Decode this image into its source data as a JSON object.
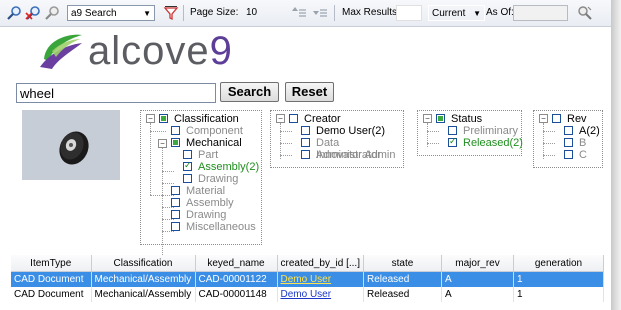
{
  "toolbar": {
    "icons": [
      "search-icon",
      "search-clear-icon",
      "search-disabled-icon"
    ],
    "search_combo": "a9 Search",
    "page_size_label": "Page Size:",
    "page_size_value": "10",
    "max_results_label": "Max Results:",
    "version_combo": "Current",
    "as_of_label": "As Of:"
  },
  "logo": {
    "text_main": "alcove",
    "text_num": "9"
  },
  "search": {
    "value": "wheel",
    "search_label": "Search",
    "reset_label": "Reset"
  },
  "facets": {
    "classification": {
      "title": "Classification",
      "items": [
        "Component",
        "Mechanical",
        "Part",
        "Assembly(2)",
        "Drawing",
        "Material",
        "Assembly",
        "Drawing",
        "Miscellaneous"
      ]
    },
    "creator": {
      "title": "Creator",
      "items": [
        "Demo User(2)",
        "Data Administrator",
        "Innovator Admin"
      ]
    },
    "status": {
      "title": "Status",
      "items": [
        "Preliminary",
        "Released(2)"
      ]
    },
    "rev": {
      "title": "Rev",
      "items": [
        "A(2)",
        "B",
        "C"
      ]
    }
  },
  "grid": {
    "columns": [
      "ItemType",
      "Classification",
      "keyed_name",
      "created_by_id [...]",
      "state",
      "major_rev",
      "generation"
    ],
    "rows": [
      [
        "CAD Document",
        "Mechanical/Assembly",
        "CAD-00001122",
        "Demo User",
        "Released",
        "A",
        "1"
      ],
      [
        "CAD Document",
        "Mechanical/Assembly",
        "CAD-00001148",
        "Demo User",
        "Released",
        "A",
        "1"
      ]
    ]
  },
  "colors": {
    "selection": "#3a8ee6",
    "accent_green": "#1f8f1f",
    "logo_purple": "#5c3e98"
  }
}
